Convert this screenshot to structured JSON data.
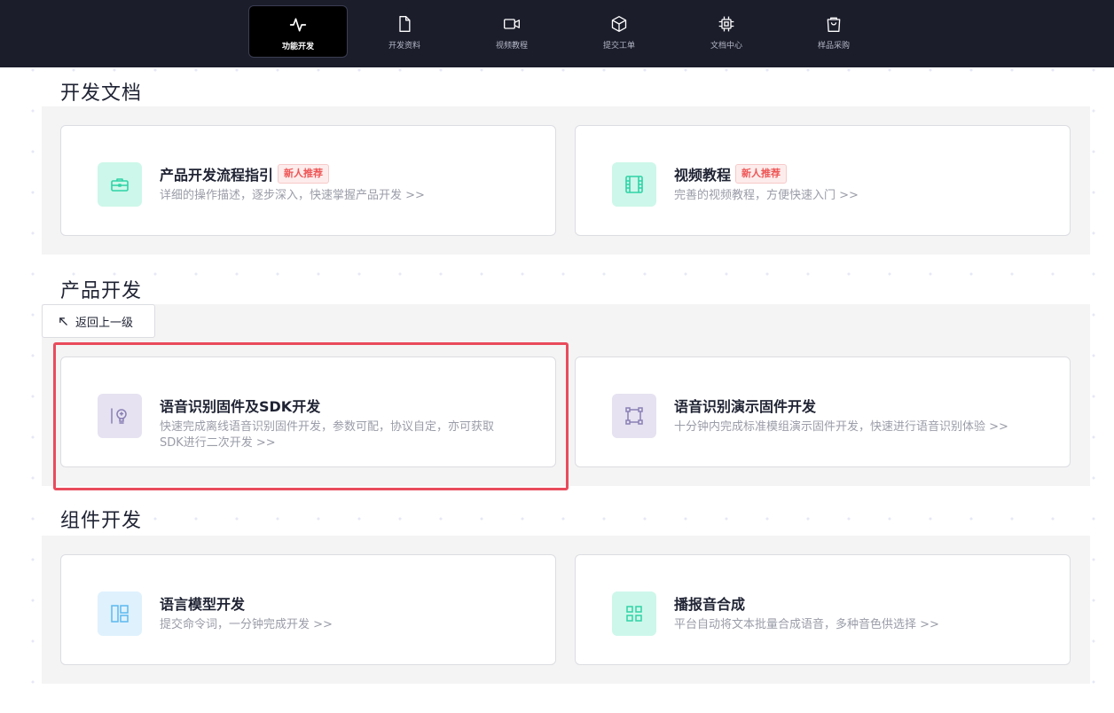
{
  "nav": {
    "items": [
      {
        "label": "功能开发",
        "icon": "activity-icon",
        "active": true
      },
      {
        "label": "开发资料",
        "icon": "file-icon",
        "active": false
      },
      {
        "label": "视频教程",
        "icon": "video-icon",
        "active": false
      },
      {
        "label": "提交工单",
        "icon": "box-icon",
        "active": false
      },
      {
        "label": "文档中心",
        "icon": "chip-icon",
        "active": false
      },
      {
        "label": "样品采购",
        "icon": "shopping-bag-icon",
        "active": false
      }
    ]
  },
  "sections": {
    "dev_docs": {
      "title": "开发文档",
      "cards": [
        {
          "title": "产品开发流程指引",
          "badge": "新人推荐",
          "desc": "详细的操作描述，逐步深入，快速掌握产品开发 >>",
          "icon": "toolbox-icon",
          "icon_color": "#2fd3a6",
          "icon_bg": "#cdf7ea"
        },
        {
          "title": "视频教程",
          "badge": "新人推荐",
          "desc": "完善的视频教程，方便快速入门 >>",
          "icon": "film-icon",
          "icon_color": "#2fd3a6",
          "icon_bg": "#cdf7ea"
        }
      ]
    },
    "product_dev": {
      "title": "产品开发",
      "back_label": "返回上一级",
      "cards": [
        {
          "title": "语音识别固件及SDK开发",
          "desc": "快速完成离线语音识别固件开发，参数可配，协议自定，亦可获取SDK进行二次开发 >>",
          "icon": "lightbulb-icon",
          "icon_color": "#8a7fb5",
          "icon_bg": "#e6e2f1"
        },
        {
          "title": "语音识别演示固件开发",
          "desc": "十分钟内完成标准模组演示固件开发，快速进行语音识别体验 >>",
          "icon": "frame-icon",
          "icon_color": "#8a7fb5",
          "icon_bg": "#e6e2f1"
        }
      ]
    },
    "component_dev": {
      "title": "组件开发",
      "cards": [
        {
          "title": "语言模型开发",
          "desc": "提交命令词，一分钟完成开发 >>",
          "icon": "layout-icon",
          "icon_color": "#5cb9ef",
          "icon_bg": "#dff1fd"
        },
        {
          "title": "播报音合成",
          "desc": "平台自动将文本批量合成语音，多种音色供选择 >>",
          "icon": "grid-icon",
          "icon_color": "#2fd3a6",
          "icon_bg": "#cdf7ea"
        }
      ]
    }
  },
  "colors": {
    "nav_bg": "#1b1d2b",
    "panel_bg": "#f4f4f4",
    "highlight": "#e94b5c",
    "badge_text": "#ee5656"
  }
}
